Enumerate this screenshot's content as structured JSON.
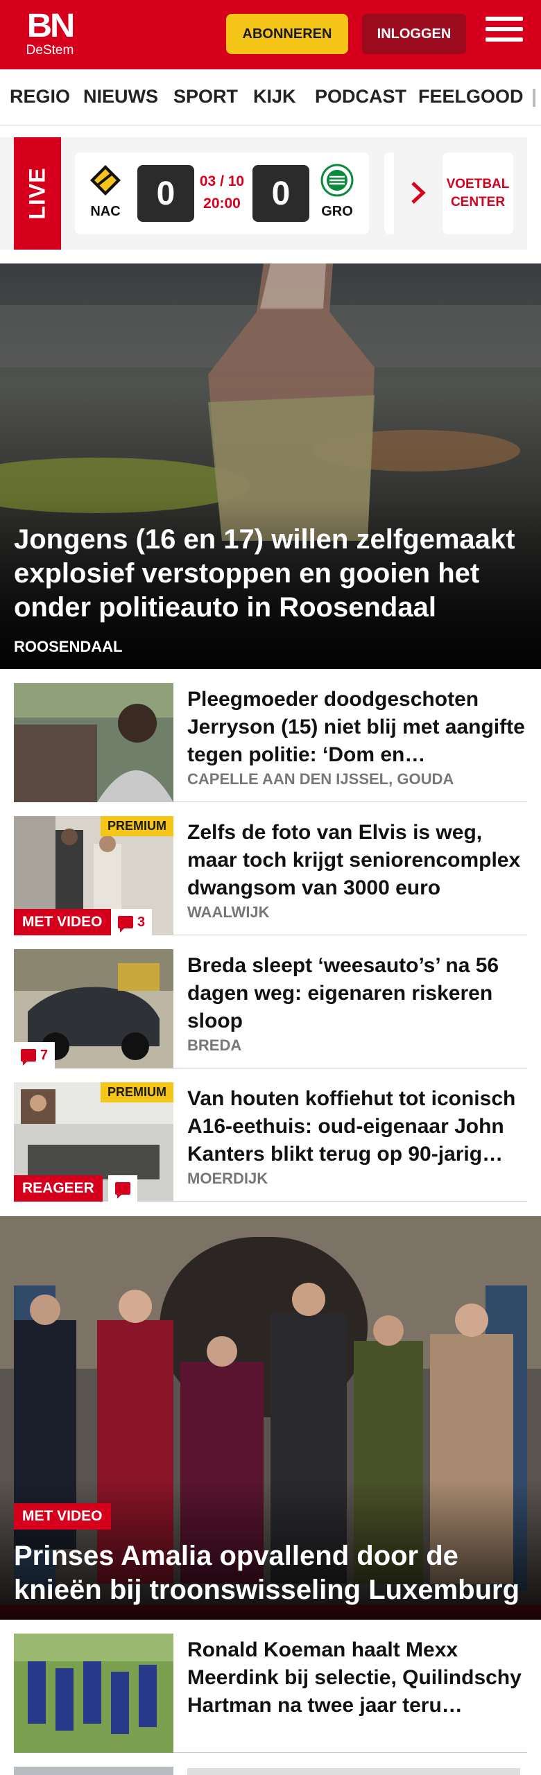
{
  "header": {
    "logo_main": "BN",
    "logo_sub": "DeStem",
    "subscribe_label": "ABONNEREN",
    "login_label": "INLOGGEN"
  },
  "nav": {
    "items": [
      "REGIO",
      "NIEUWS",
      "SPORT",
      "KIJK",
      "PODCAST",
      "FEELGOOD"
    ]
  },
  "live": {
    "label": "LIVE",
    "home_team": "NAC",
    "home_score": "0",
    "away_team": "GRO",
    "away_score": "0",
    "date": "03 / 10",
    "time": "20:00",
    "voetbal_center": "VOETBAL CENTER"
  },
  "hero": {
    "title": "Jongens (16 en 17) willen zelfgemaakt explosief verstoppen en gooien het onder politieauto in Roosendaal",
    "location": "ROOSENDAAL"
  },
  "articles": [
    {
      "title": "Pleegmoeder doodgeschoten Jerryson (15) niet blij met aangifte tegen politie: ‘Dom en…",
      "location": "CAPELLE AAN DEN IJSSEL, GOUDA"
    },
    {
      "title": "Zelfs de foto van Elvis is weg, maar toch krijgt seniorencom­plex dwangsom van 3000 euro",
      "location": "WAALWIJK",
      "premium": "PREMIUM",
      "video": "MET VIDEO",
      "comments": "3"
    },
    {
      "title": "Breda sleept ‘weesauto’s’ na 56 dagen weg: eigenaren riskeren sloop",
      "location": "BREDA",
      "comments": "7"
    },
    {
      "title": "Van houten koffiehut tot iconisch A16-eethuis: oud-eigenaar John Kanters blikt terug op 90-jarig…",
      "location": "MOERDIJK",
      "premium": "PREMIUM",
      "reageer": "REAGEER"
    }
  ],
  "hero2": {
    "video": "MET VIDEO",
    "title": "Prinses Amalia opvallend door de knieën bij troonswisseling Luxemburg"
  },
  "article_last": {
    "title": "Ronald Koeman haalt Mexx Meerdink bij selectie, Quilind­schy Hartman na twee jaar teru…"
  },
  "colors": {
    "brand_red": "#d6001c",
    "premium_yellow": "#f5c518",
    "login_dark_red": "#9c0a1e"
  },
  "icons": [
    "menu-icon",
    "nac-crest-icon",
    "groningen-crest-icon",
    "chevron-right-icon",
    "comment-icon"
  ]
}
